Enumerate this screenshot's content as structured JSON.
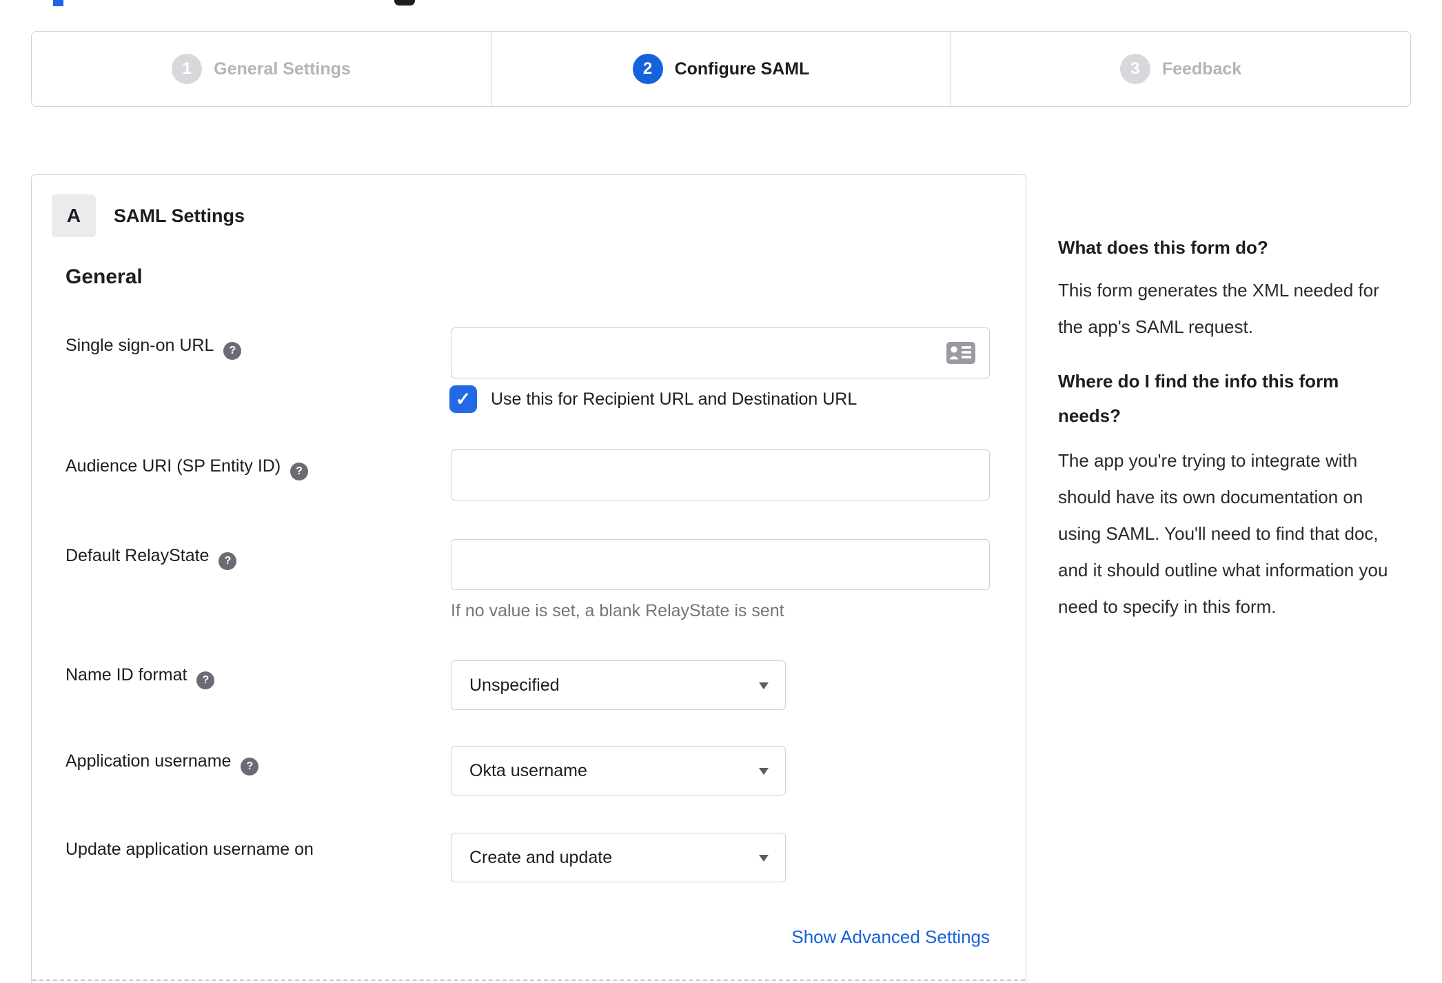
{
  "colors": {
    "accent_blue": "#1662dd",
    "checkbox_blue": "#2368e4",
    "link_blue": "#1662dd",
    "inactive_gray": "#d8d8dc",
    "border_gray": "#d2d2d7"
  },
  "icons": {
    "help": "?",
    "check": "✓",
    "dropdown_arrow": "▼",
    "sso_field_icon": "contact-card"
  },
  "stepper": {
    "steps": [
      {
        "number": "1",
        "label": "General Settings",
        "state": "inactive"
      },
      {
        "number": "2",
        "label": "Configure SAML",
        "state": "active"
      },
      {
        "number": "3",
        "label": "Feedback",
        "state": "inactive"
      }
    ]
  },
  "form": {
    "section_badge": "A",
    "section_title": "SAML Settings",
    "group_title": "General",
    "fields": {
      "sso_url": {
        "label": "Single sign-on URL",
        "value": "",
        "checkbox_label": "Use this for Recipient URL and Destination URL",
        "checkbox_checked": true
      },
      "audience_uri": {
        "label": "Audience URI (SP Entity ID)",
        "value": ""
      },
      "relay_state": {
        "label": "Default RelayState",
        "value": "",
        "hint": "If no value is set, a blank RelayState is sent"
      },
      "name_id_format": {
        "label": "Name ID format",
        "value": "Unspecified"
      },
      "app_username": {
        "label": "Application username",
        "value": "Okta username"
      },
      "update_app_username": {
        "label": "Update application username on",
        "value": "Create and update"
      }
    },
    "advanced_link": "Show Advanced Settings"
  },
  "sidebar": {
    "section1_title": "What does this form do?",
    "section1_body": "This form generates the XML needed for the app's SAML request.",
    "section2_title": "Where do I find the info this form needs?",
    "section2_body": "The app you're trying to integrate with should have its own documentation on using SAML. You'll need to find that doc, and it should outline what information you need to specify in this form."
  }
}
